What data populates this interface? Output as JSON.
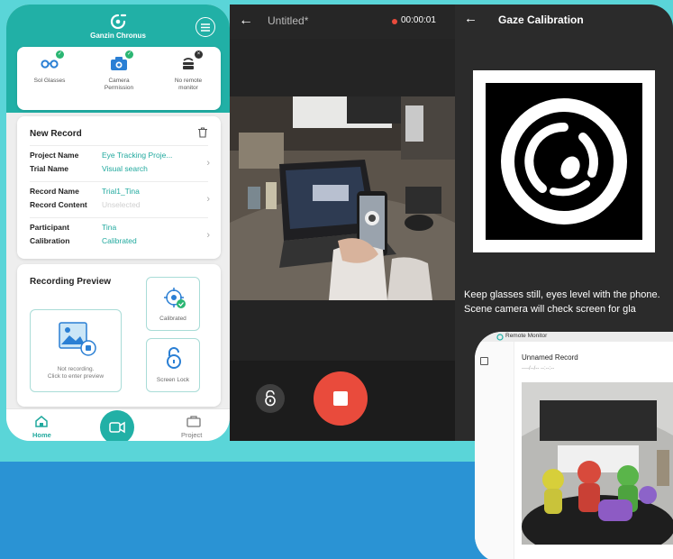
{
  "colors": {
    "brand": "#21b0a6",
    "accent_text": "#21a99e",
    "band": "#5ad5d8",
    "lower_background": "#2a93d4",
    "record_red": "#e94b3c",
    "ok_green": "#2bb673"
  },
  "app": {
    "title": "Ganzin Chronus",
    "status_items": [
      {
        "icon": "glasses-icon",
        "label": "Sol Glasses",
        "state": "ok"
      },
      {
        "icon": "camera-icon",
        "label": "Camera\nPermission",
        "state": "ok"
      },
      {
        "icon": "remote-monitor-icon",
        "label": "No remote\nmonitor",
        "state": "off"
      }
    ],
    "new_record": {
      "title": "New Record",
      "rows": [
        {
          "key": "Project Name",
          "value": "Eye Tracking Proje..."
        },
        {
          "key": "Trial Name",
          "value": "Visual search"
        },
        {
          "key": "Record Name",
          "value": "Trial1_Tina"
        },
        {
          "key": "Record Content",
          "value": "Unselected"
        },
        {
          "key": "Participant",
          "value": "Tina"
        },
        {
          "key": "Calibration",
          "value": "Calibrated"
        }
      ]
    },
    "preview": {
      "title": "Recording Preview",
      "not_recording": "Not recording.\nClick to enter preview",
      "calibrated": "Calibrated",
      "screen_lock": "Screen Lock"
    },
    "nav": {
      "home": "Home",
      "project": "Project"
    }
  },
  "recorder": {
    "title": "Untitled*",
    "timer": "00:00:01"
  },
  "calibration": {
    "title": "Gaze Calibration",
    "instruction": "Keep glasses still, eyes level with the phone. Scene camera will check screen for gla"
  },
  "remote_monitor": {
    "window_title": "Remote Monitor",
    "record_name": "Unnamed Record",
    "date_placeholder": "----/--/-- --:--:--"
  }
}
